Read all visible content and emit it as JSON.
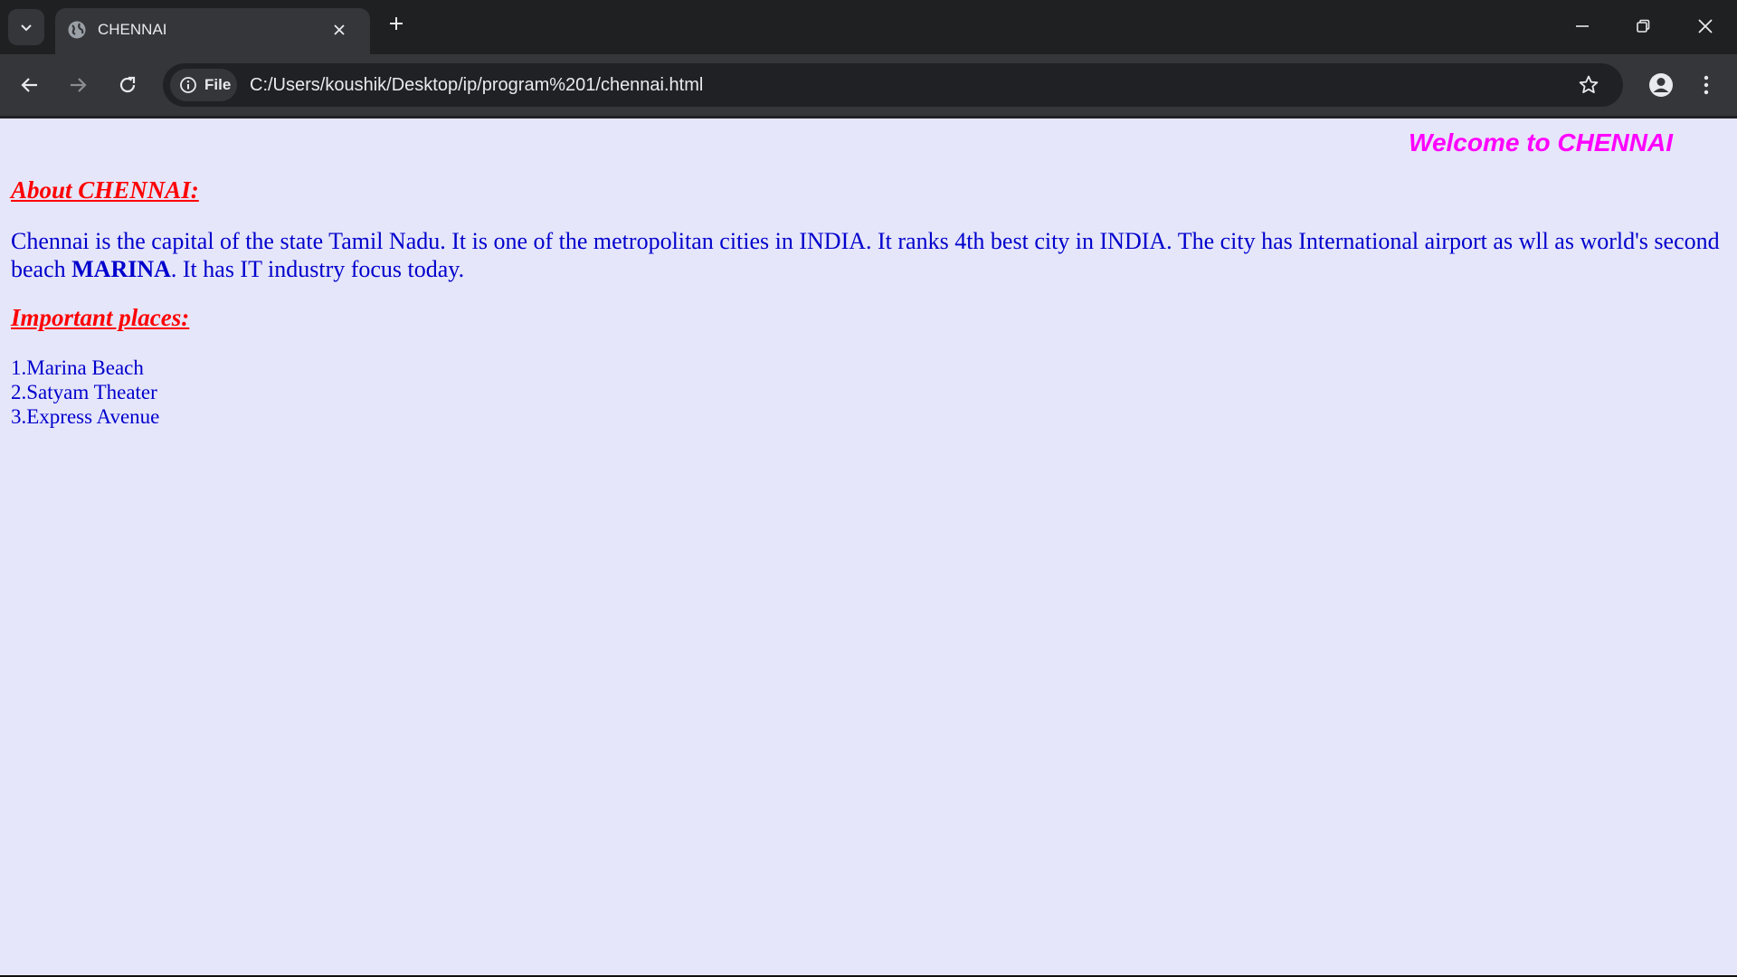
{
  "browser": {
    "tab": {
      "title": "CHENNAI"
    },
    "omnibox": {
      "chip_label": "File",
      "url": "C:/Users/koushik/Desktop/ip/program%201/chennai.html"
    },
    "icons": {
      "tab_search": "chevron-down-icon",
      "favicon": "globe-icon",
      "tab_close": "close-icon",
      "new_tab": "plus-icon",
      "minimize": "minimize-icon",
      "restore": "restore-icon",
      "close_window": "close-icon",
      "back": "arrow-left-icon",
      "forward": "arrow-right-icon",
      "reload": "reload-icon",
      "site_info": "info-icon",
      "bookmark": "star-icon",
      "profile": "person-icon",
      "menu": "kebab-menu-icon"
    },
    "colors": {
      "frame": "#202124",
      "toolbar": "#35363a",
      "text": "#e8eaed"
    }
  },
  "page": {
    "welcome": "Welcome to CHENNAI",
    "about_heading": "About CHENNAI:",
    "about_text_1": "Chennai is the capital of the state Tamil Nadu. It is one of the metropolitan cities in INDIA. It ranks 4th best city in INDIA. The city has International airport as wll as world's second beach ",
    "about_text_bold": "MARINA",
    "about_text_2": ". It has IT industry focus today.",
    "places_heading": "Important places:",
    "places": [
      "1.Marina Beach",
      "2.Satyam Theater",
      "3.Express Avenue"
    ],
    "colors": {
      "background": "#e6e6fa",
      "welcome": "#ff00ff",
      "heading": "#ff0000",
      "body_text": "#0000cd"
    }
  }
}
